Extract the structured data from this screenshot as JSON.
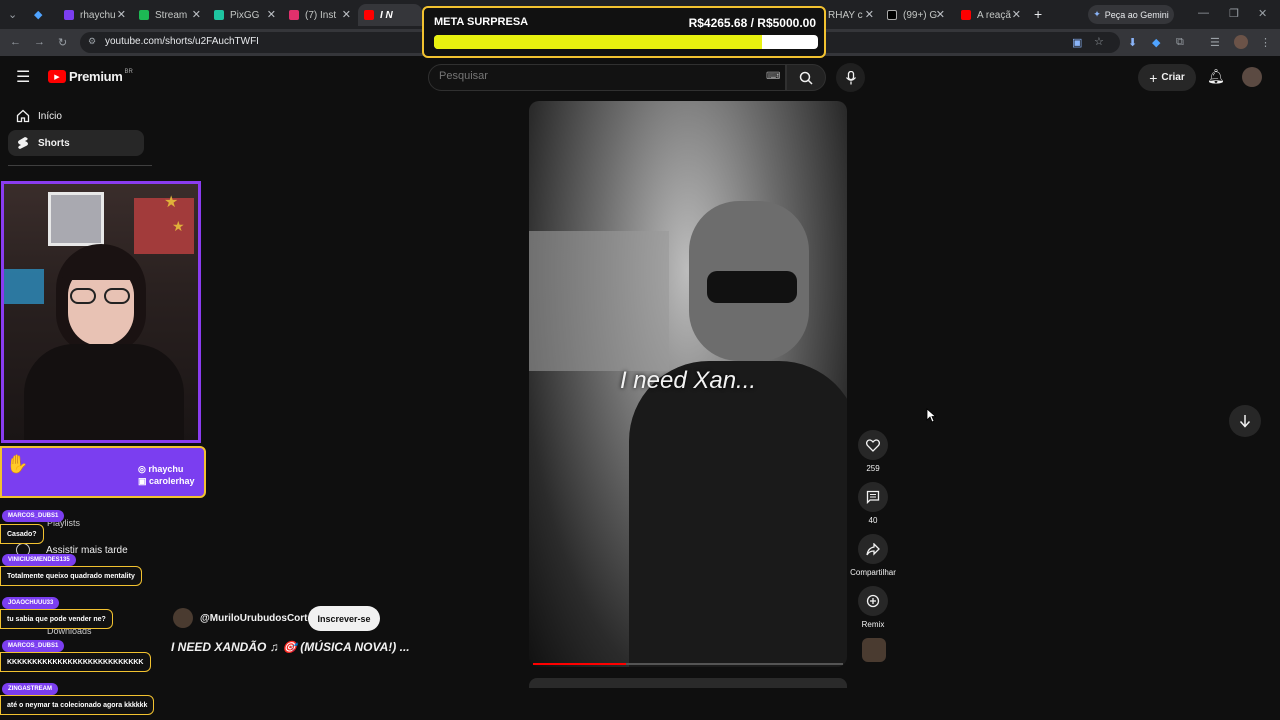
{
  "browser": {
    "tabs": [
      {
        "label": "rhaychu",
        "color": "#7b3ef0"
      },
      {
        "label": "Stream",
        "color": "#1db954"
      },
      {
        "label": "PixGG",
        "color": "#1ec4a0"
      },
      {
        "label": "(7) Inst",
        "color": "#e1306c"
      },
      {
        "label": "I N",
        "color": "#ff0000"
      },
      {
        "label": "RHAY c",
        "color": "#ff0000"
      },
      {
        "label": "(99+) G",
        "color": "#000000"
      },
      {
        "label": "A reaçã",
        "color": "#ff0000"
      }
    ],
    "new_tab": "+",
    "gemini": "Peça ao Gemini",
    "url": "youtube.com/shorts/u2FAuchTWFI"
  },
  "goal": {
    "label": "META SURPRESA",
    "amount": "R$4265.68 / R$5000.00",
    "progress": 0.853
  },
  "youtube": {
    "logo": "Premium",
    "region": "BR",
    "search_placeholder": "Pesquisar",
    "create": "Criar",
    "sidebar": [
      {
        "label": "Início",
        "icon": "home-icon"
      },
      {
        "label": "Shorts",
        "icon": "shorts-icon"
      }
    ],
    "sidebar_hidden": [
      "Playlists",
      "Assistir mais tarde",
      "Downloads"
    ]
  },
  "overlay": {
    "social": [
      "rhaychu",
      "carolerhay"
    ]
  },
  "chat": [
    {
      "user": "MARCOS_DUBS1",
      "msg": "Casado?"
    },
    {
      "user": "VINICIUSMENDES135",
      "msg": "Totalmente queixo quadrado mentality"
    },
    {
      "user": "JOAOCHUUU33",
      "msg": "tu sabia que pode vender ne?"
    },
    {
      "user": "MARCOS_DUBS1",
      "msg": "KKKKKKKKKKKKKKKKKKKKKKKKKKK"
    },
    {
      "user": "ZINGASTREAM",
      "msg": "até o neymar ta colecionado agora kkkkkk"
    }
  ],
  "short": {
    "caption": "I need Xan...",
    "channel": "@MuriloUrubudosCortes",
    "subscribe": "Inscrever-se",
    "title": "I NEED XANDÃO ♫ 🎯 (MÚSICA NOVA!) ...",
    "progress": 0.3,
    "actions": [
      {
        "label": "259",
        "icon": "like-icon"
      },
      {
        "label": "40",
        "icon": "comment-icon"
      },
      {
        "label": "Compartilhar",
        "icon": "share-icon"
      },
      {
        "label": "Remix",
        "icon": "remix-icon"
      }
    ]
  }
}
